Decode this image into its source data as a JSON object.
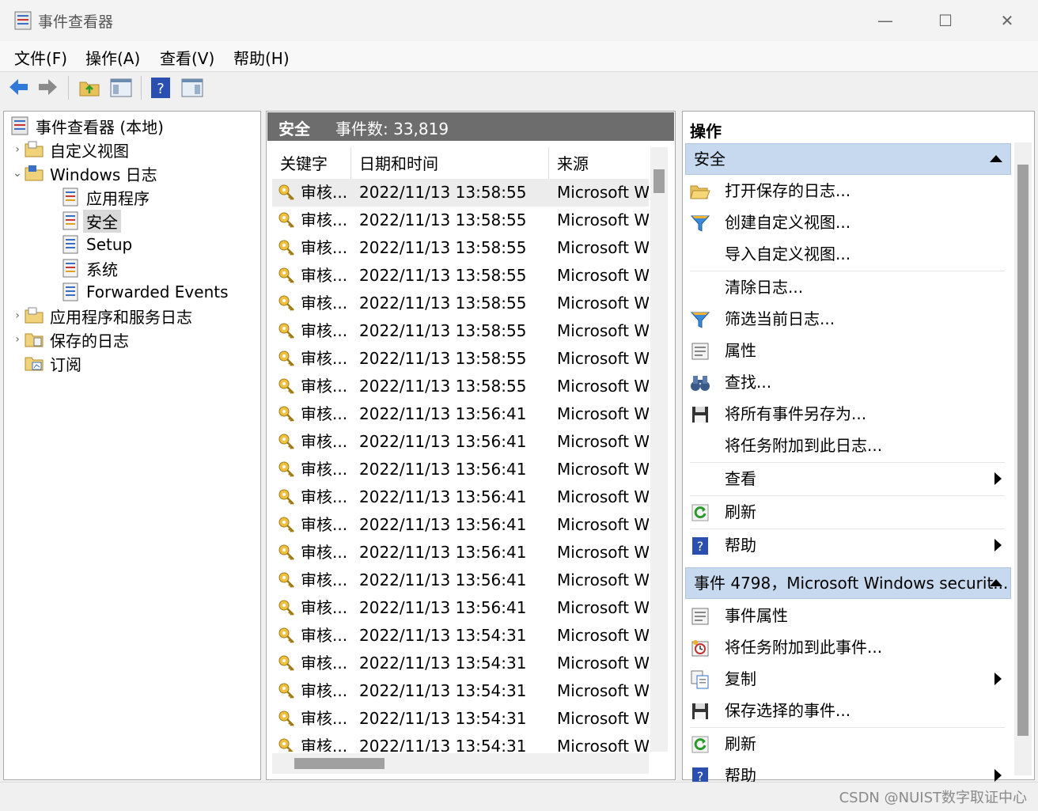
{
  "window": {
    "title": "事件查看器",
    "controls": {
      "minimize": "—",
      "maximize": "☐",
      "close": "✕"
    }
  },
  "menu": [
    "文件(F)",
    "操作(A)",
    "查看(V)",
    "帮助(H)"
  ],
  "toolbar": {
    "icons": [
      "back-arrow-icon",
      "forward-arrow-icon",
      "up-folder-icon",
      "show-pane-icon",
      "help-icon",
      "action-pane-icon"
    ]
  },
  "tree": {
    "root": "事件查看器 (本地)",
    "custom_views": "自定义视图",
    "windows_logs": "Windows 日志",
    "windows_children": [
      "应用程序",
      "安全",
      "Setup",
      "系统",
      "Forwarded Events"
    ],
    "selected": "安全",
    "app_service_logs": "应用程序和服务日志",
    "saved_logs": "保存的日志",
    "subscriptions": "订阅"
  },
  "middle": {
    "log_name": "安全",
    "event_count": "事件数: 33,819",
    "columns": [
      "关键字",
      "日期和时间",
      "来源"
    ],
    "rows": [
      {
        "kw": "审核...",
        "dt": "2022/11/13 13:58:55",
        "src": "Microsoft Wi"
      },
      {
        "kw": "审核...",
        "dt": "2022/11/13 13:58:55",
        "src": "Microsoft Wi"
      },
      {
        "kw": "审核...",
        "dt": "2022/11/13 13:58:55",
        "src": "Microsoft Wi"
      },
      {
        "kw": "审核...",
        "dt": "2022/11/13 13:58:55",
        "src": "Microsoft Wi"
      },
      {
        "kw": "审核...",
        "dt": "2022/11/13 13:58:55",
        "src": "Microsoft Wi"
      },
      {
        "kw": "审核...",
        "dt": "2022/11/13 13:58:55",
        "src": "Microsoft Wi"
      },
      {
        "kw": "审核...",
        "dt": "2022/11/13 13:58:55",
        "src": "Microsoft Wi"
      },
      {
        "kw": "审核...",
        "dt": "2022/11/13 13:58:55",
        "src": "Microsoft Wi"
      },
      {
        "kw": "审核...",
        "dt": "2022/11/13 13:56:41",
        "src": "Microsoft Wi"
      },
      {
        "kw": "审核...",
        "dt": "2022/11/13 13:56:41",
        "src": "Microsoft Wi"
      },
      {
        "kw": "审核...",
        "dt": "2022/11/13 13:56:41",
        "src": "Microsoft Wi"
      },
      {
        "kw": "审核...",
        "dt": "2022/11/13 13:56:41",
        "src": "Microsoft Wi"
      },
      {
        "kw": "审核...",
        "dt": "2022/11/13 13:56:41",
        "src": "Microsoft Wi"
      },
      {
        "kw": "审核...",
        "dt": "2022/11/13 13:56:41",
        "src": "Microsoft Wi"
      },
      {
        "kw": "审核...",
        "dt": "2022/11/13 13:56:41",
        "src": "Microsoft Wi"
      },
      {
        "kw": "审核...",
        "dt": "2022/11/13 13:56:41",
        "src": "Microsoft Wi"
      },
      {
        "kw": "审核...",
        "dt": "2022/11/13 13:54:31",
        "src": "Microsoft Wi"
      },
      {
        "kw": "审核...",
        "dt": "2022/11/13 13:54:31",
        "src": "Microsoft Wi"
      },
      {
        "kw": "审核...",
        "dt": "2022/11/13 13:54:31",
        "src": "Microsoft Wi"
      },
      {
        "kw": "审核...",
        "dt": "2022/11/13 13:54:31",
        "src": "Microsoft Wi"
      },
      {
        "kw": "审核...",
        "dt": "2022/11/13 13:54:31",
        "src": "Microsoft Wi"
      }
    ]
  },
  "actions": {
    "title": "操作",
    "section1": {
      "header": "安全",
      "items": [
        {
          "label": "打开保存的日志...",
          "icon": "open-folder-icon",
          "submenu": false
        },
        {
          "label": "创建自定义视图...",
          "icon": "filter-icon",
          "submenu": false
        },
        {
          "label": "导入自定义视图...",
          "icon": "",
          "submenu": false
        },
        {
          "label": "清除日志...",
          "icon": "",
          "submenu": false
        },
        {
          "label": "筛选当前日志...",
          "icon": "filter-icon",
          "submenu": false
        },
        {
          "label": "属性",
          "icon": "properties-icon",
          "submenu": false
        },
        {
          "label": "查找...",
          "icon": "binoculars-icon",
          "submenu": false
        },
        {
          "label": "将所有事件另存为...",
          "icon": "save-icon",
          "submenu": false
        },
        {
          "label": "将任务附加到此日志...",
          "icon": "",
          "submenu": false
        },
        {
          "label": "查看",
          "icon": "",
          "submenu": true
        },
        {
          "label": "刷新",
          "icon": "refresh-icon",
          "submenu": false
        },
        {
          "label": "帮助",
          "icon": "help-icon",
          "submenu": true
        }
      ]
    },
    "section2": {
      "header": "事件 4798，Microsoft Windows securit...",
      "items": [
        {
          "label": "事件属性",
          "icon": "properties-icon",
          "submenu": false
        },
        {
          "label": "将任务附加到此事件...",
          "icon": "task-clock-icon",
          "submenu": false
        },
        {
          "label": "复制",
          "icon": "copy-icon",
          "submenu": true
        },
        {
          "label": "保存选择的事件...",
          "icon": "save-icon",
          "submenu": false
        },
        {
          "label": "刷新",
          "icon": "refresh-icon",
          "submenu": false
        },
        {
          "label": "帮助",
          "icon": "help-icon",
          "submenu": true
        }
      ]
    }
  },
  "watermark": "CSDN @NUIST数字取证中心",
  "colors": {
    "section_header": "#c7d9ef",
    "middle_header": "#6d6d6d",
    "selection": "#d9d9d9"
  }
}
